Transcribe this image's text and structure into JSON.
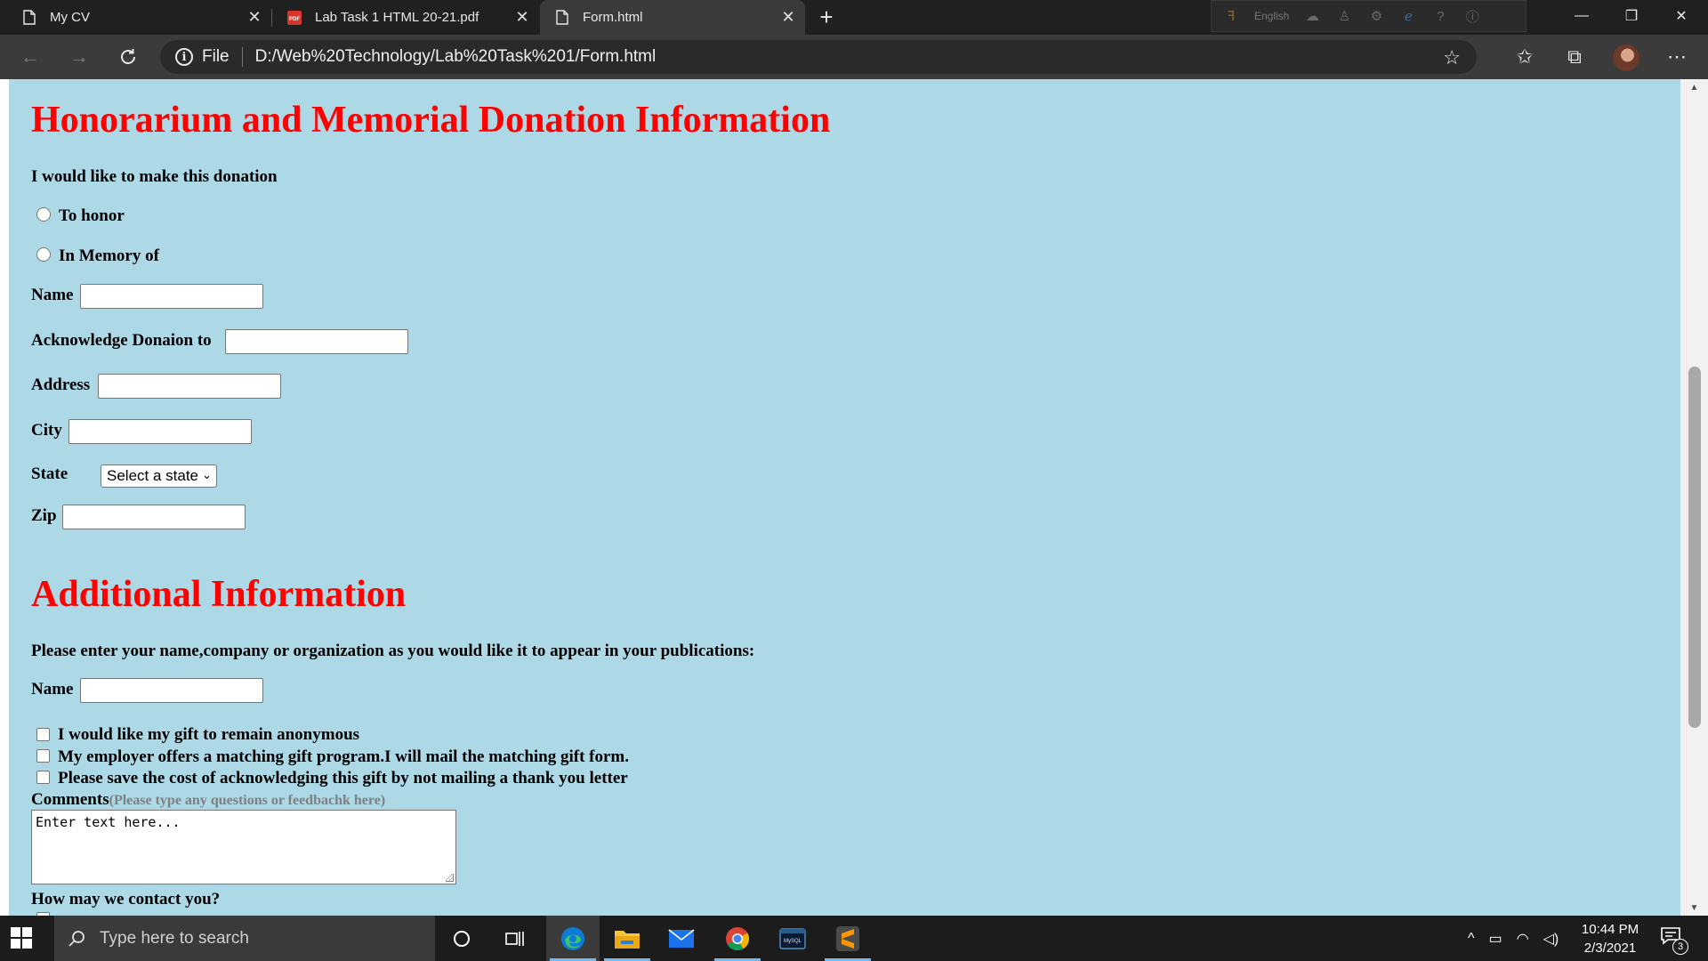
{
  "browser": {
    "tabs": [
      {
        "title": "My CV",
        "icon": "page-icon",
        "active": false
      },
      {
        "title": "Lab Task 1 HTML 20-21.pdf",
        "icon": "pdf-icon",
        "active": false
      },
      {
        "title": "Form.html",
        "icon": "page-icon",
        "active": true
      }
    ],
    "extension_language": "English",
    "address": {
      "scheme_label": "File",
      "url": "D:/Web%20Technology/Lab%20Task%201/Form.html"
    }
  },
  "page": {
    "section1": {
      "heading": "Honorarium and Memorial Donation Information",
      "intro": "I would like to make this donation",
      "radio_honor": "To honor",
      "radio_memory": "In Memory of",
      "name_label": "Name",
      "ack_label": "Acknowledge Donaion to",
      "address_label": "Address",
      "city_label": "City",
      "state_label": "State",
      "state_selected": "Select a state",
      "zip_label": "Zip"
    },
    "section2": {
      "heading": "Additional Information",
      "intro": "Please enter your name,company or organization as you would like it to appear in your publications:",
      "name_label": "Name",
      "check_anonymous": "I would like my gift to remain anonymous",
      "check_employer": "My employer offers a matching gift program.I will mail the matching gift form.",
      "check_save_cost": "Please save the cost of acknowledging this gift by not mailing a thank you letter",
      "comments_label": "Comments",
      "comments_hint": "(Please type any questions or feedbachk here)",
      "comments_value": "Enter text here...",
      "contact_label": "How may we contact you?"
    }
  },
  "taskbar": {
    "search_placeholder": "Type here to search",
    "time": "10:44 PM",
    "date": "2/3/2021",
    "notification_count": "3"
  },
  "colors": {
    "page_background": "#add8e6",
    "heading_red": "#ff0000"
  }
}
